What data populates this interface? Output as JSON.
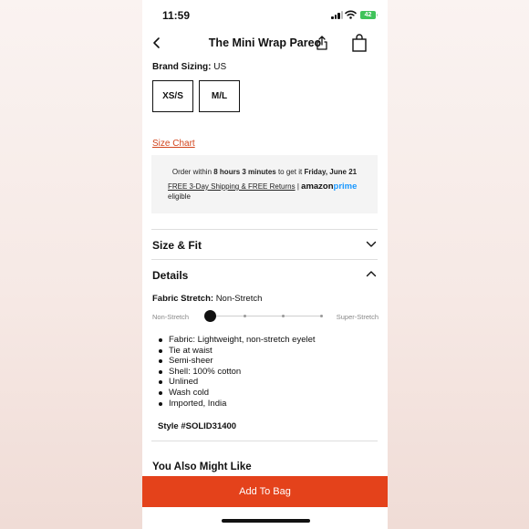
{
  "status": {
    "time": "11:59",
    "battery": "42"
  },
  "nav": {
    "title": "The Mini Wrap Pareo"
  },
  "sizing": {
    "label": "Brand Sizing:",
    "value": "US",
    "options": [
      "XS/S",
      "M/L"
    ],
    "size_chart": "Size Chart"
  },
  "delivery": {
    "order_prefix": "Order within",
    "order_time": "8 hours 3 minutes",
    "order_mid": "to get it",
    "order_date": "Friday, June 21",
    "shipping_link": "FREE 3-Day Shipping & FREE Returns",
    "separator": "|",
    "amazon": "amazon",
    "prime": "prime",
    "eligible": "eligible"
  },
  "size_fit": {
    "title": "Size & Fit"
  },
  "details": {
    "title": "Details",
    "stretch_label": "Fabric Stretch:",
    "stretch_value": "Non-Stretch",
    "stretch_low": "Non-Stretch",
    "stretch_high": "Super-Stretch",
    "stretch_level": 0,
    "features": [
      "Fabric: Lightweight, non-stretch eyelet",
      "Tie at waist",
      "Semi-sheer",
      "Shell: 100% cotton",
      "Unlined",
      "Wash cold",
      "Imported, India"
    ],
    "style": "Style #SOLID31400"
  },
  "recommendations": {
    "title": "You Also Might Like"
  },
  "cta": {
    "label": "Add To Bag"
  },
  "colors": {
    "accent": "#e4421b",
    "link": "#d2441c",
    "prime": "#1a98ff"
  }
}
